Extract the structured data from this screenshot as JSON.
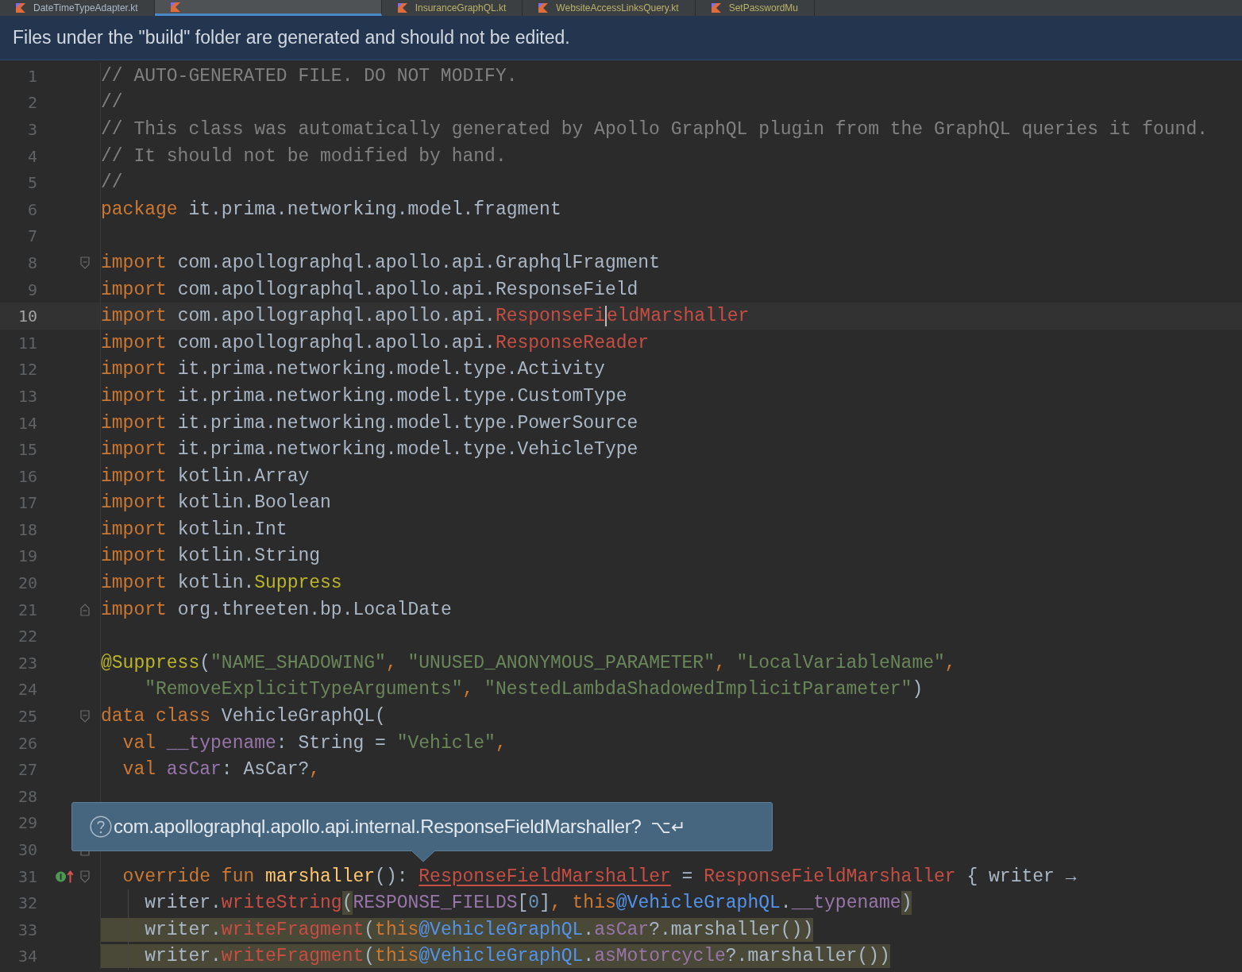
{
  "tabs": [
    {
      "label": "DateTimeTypeAdapter.kt",
      "selected": false
    },
    {
      "selected": true
    },
    {
      "label": "InsuranceGraphQL.kt",
      "selected": false
    },
    {
      "label": "WebsiteAccessLinksQuery.kt",
      "selected": false
    },
    {
      "label": "SetPasswordMu",
      "selected": false
    }
  ],
  "banner": {
    "text": "Files under the \"build\" folder are generated and should not be edited."
  },
  "lines": [
    {
      "n": "1",
      "tokens": [
        {
          "kind": "comment",
          "t": "// AUTO-GENERATED FILE. DO NOT MODIFY."
        }
      ]
    },
    {
      "n": "2",
      "tokens": [
        {
          "kind": "comment",
          "t": "//"
        }
      ]
    },
    {
      "n": "3",
      "tokens": [
        {
          "kind": "comment",
          "t": "// This class was automatically generated by Apollo GraphQL plugin from the GraphQL queries it found."
        }
      ]
    },
    {
      "n": "4",
      "tokens": [
        {
          "kind": "comment",
          "t": "// It should not be modified by hand."
        }
      ]
    },
    {
      "n": "5",
      "tokens": [
        {
          "kind": "comment",
          "t": "//"
        }
      ]
    },
    {
      "n": "6",
      "tokens": [
        {
          "kind": "keyword",
          "t": "package"
        },
        {
          "kind": "plain",
          "t": " it.prima.networking.model.fragment"
        }
      ]
    },
    {
      "n": "7"
    },
    {
      "n": "8",
      "fold_start": true,
      "tokens": [
        {
          "kind": "keyword",
          "t": "import"
        },
        {
          "kind": "plain",
          "t": " com.apollographql.apollo.api.GraphqlFragment"
        }
      ]
    },
    {
      "n": "9",
      "tokens": [
        {
          "kind": "keyword",
          "t": "import"
        },
        {
          "kind": "plain",
          "t": " com.apollographql.apollo.api.ResponseField"
        }
      ]
    },
    {
      "n": "10",
      "current": true,
      "tokens": [
        {
          "kind": "keyword",
          "t": "import"
        },
        {
          "kind": "plain",
          "t": " com.apollographql.apollo.api."
        },
        {
          "kind": "error",
          "t": "ResponseFi",
          "caret": true
        },
        {
          "kind": "error",
          "t": "eldMarshaller"
        }
      ]
    },
    {
      "n": "11",
      "tokens": [
        {
          "kind": "keyword",
          "t": "import"
        },
        {
          "kind": "plain",
          "t": " com.apollographql.apollo.api."
        },
        {
          "kind": "error",
          "t": "ResponseReader"
        }
      ]
    },
    {
      "n": "12",
      "tokens": [
        {
          "kind": "keyword",
          "t": "import"
        },
        {
          "kind": "plain",
          "t": " it.prima.networking.model.type.Activity"
        }
      ]
    },
    {
      "n": "13",
      "tokens": [
        {
          "kind": "keyword",
          "t": "import"
        },
        {
          "kind": "plain",
          "t": " it.prima.networking.model.type.CustomType"
        }
      ]
    },
    {
      "n": "14",
      "tokens": [
        {
          "kind": "keyword",
          "t": "import"
        },
        {
          "kind": "plain",
          "t": " it.prima.networking.model.type.PowerSource"
        }
      ]
    },
    {
      "n": "15",
      "tokens": [
        {
          "kind": "keyword",
          "t": "import"
        },
        {
          "kind": "plain",
          "t": " it.prima.networking.model.type.VehicleType"
        }
      ]
    },
    {
      "n": "16",
      "tokens": [
        {
          "kind": "keyword",
          "t": "import"
        },
        {
          "kind": "plain",
          "t": " kotlin.Array"
        }
      ]
    },
    {
      "n": "17",
      "tokens": [
        {
          "kind": "keyword",
          "t": "import"
        },
        {
          "kind": "plain",
          "t": " kotlin.Boolean"
        }
      ]
    },
    {
      "n": "18",
      "tokens": [
        {
          "kind": "keyword",
          "t": "import"
        },
        {
          "kind": "plain",
          "t": " kotlin.Int"
        }
      ]
    },
    {
      "n": "19",
      "tokens": [
        {
          "kind": "keyword",
          "t": "import"
        },
        {
          "kind": "plain",
          "t": " kotlin.String"
        }
      ]
    },
    {
      "n": "20",
      "tokens": [
        {
          "kind": "keyword",
          "t": "import"
        },
        {
          "kind": "plain",
          "t": " kotlin."
        },
        {
          "kind": "annotation",
          "t": "Suppress"
        }
      ]
    },
    {
      "n": "21",
      "fold_end": true,
      "tokens": [
        {
          "kind": "keyword",
          "t": "import"
        },
        {
          "kind": "plain",
          "t": " org.threeten.bp.LocalDate"
        }
      ]
    },
    {
      "n": "22"
    },
    {
      "n": "23",
      "tokens": [
        {
          "kind": "annotation",
          "t": "@Suppress"
        },
        {
          "kind": "plain",
          "t": "("
        },
        {
          "kind": "string",
          "t": "\"NAME_SHADOWING\""
        },
        {
          "kind": "keyword",
          "t": ", "
        },
        {
          "kind": "string",
          "t": "\"UNUSED_ANONYMOUS_PARAMETER\""
        },
        {
          "kind": "keyword",
          "t": ", "
        },
        {
          "kind": "string",
          "t": "\"LocalVariableName\""
        },
        {
          "kind": "keyword",
          "t": ","
        }
      ]
    },
    {
      "n": "24",
      "tokens": [
        {
          "kind": "string",
          "t": "    \"RemoveExplicitTypeArguments\""
        },
        {
          "kind": "keyword",
          "t": ", "
        },
        {
          "kind": "string",
          "t": "\"NestedLambdaShadowedImplicitParameter\""
        },
        {
          "kind": "plain",
          "t": ")"
        }
      ]
    },
    {
      "n": "25",
      "fold_start": true,
      "tokens": [
        {
          "kind": "keyword",
          "t": "data class"
        },
        {
          "kind": "plain",
          "t": " VehicleGraphQL("
        }
      ]
    },
    {
      "n": "26",
      "tokens": [
        {
          "kind": "keyword",
          "t": "  val "
        },
        {
          "kind": "prop",
          "t": "__typename"
        },
        {
          "kind": "plain",
          "t": ": String = "
        },
        {
          "kind": "string",
          "t": "\"Vehicle\""
        },
        {
          "kind": "keyword",
          "t": ","
        }
      ]
    },
    {
      "n": "27",
      "tokens": [
        {
          "kind": "keyword",
          "t": "  val "
        },
        {
          "kind": "prop",
          "t": "asCar"
        },
        {
          "kind": "plain",
          "t": ": AsCar?"
        },
        {
          "kind": "keyword",
          "t": ","
        }
      ]
    },
    {
      "n": "28"
    },
    {
      "n": "29"
    },
    {
      "n": "30",
      "fold_end": true
    },
    {
      "n": "31",
      "fold_start": true,
      "implements": true,
      "tokens": [
        {
          "kind": "keyword",
          "t": "  override fun "
        },
        {
          "kind": "fn",
          "t": "marshaller"
        },
        {
          "kind": "plain",
          "t": "(): "
        },
        {
          "kind": "error_ul",
          "t": "ResponseFieldMarshaller"
        },
        {
          "kind": "plain",
          "t": " = "
        },
        {
          "kind": "error",
          "t": "ResponseFieldMarshaller"
        },
        {
          "kind": "plain",
          "t": " { writer →"
        }
      ]
    },
    {
      "n": "32",
      "guide": true,
      "tokens": [
        {
          "kind": "plain",
          "t": "    writer."
        },
        {
          "kind": "error",
          "t": "writeString"
        },
        {
          "kind": "plain",
          "t": "(",
          "hl": true
        },
        {
          "kind": "prop",
          "t": "RESPONSE_FIELDS"
        },
        {
          "kind": "plain",
          "t": "["
        },
        {
          "kind": "number",
          "t": "0"
        },
        {
          "kind": "plain",
          "t": "]"
        },
        {
          "kind": "keyword",
          "t": ", this"
        },
        {
          "kind": "label",
          "t": "@VehicleGraphQL"
        },
        {
          "kind": "plain",
          "t": "."
        },
        {
          "kind": "prop",
          "t": "__typename"
        },
        {
          "kind": "plain",
          "t": ")",
          "hl": true
        }
      ]
    },
    {
      "n": "33",
      "guide": true,
      "tokens": [
        {
          "kind": "plain",
          "t": "    writer.",
          "hl": true
        },
        {
          "kind": "error",
          "t": "writeFragment",
          "hl": true
        },
        {
          "kind": "plain",
          "t": "(",
          "hl": true
        },
        {
          "kind": "keyword",
          "t": "this",
          "hl": true
        },
        {
          "kind": "label",
          "t": "@VehicleGraphQL",
          "hl": true
        },
        {
          "kind": "plain",
          "t": ".",
          "hl": true
        },
        {
          "kind": "prop",
          "t": "asCar",
          "hl": true
        },
        {
          "kind": "plain",
          "t": "?.marshaller())",
          "hl": true
        }
      ]
    },
    {
      "n": "34",
      "guide": true,
      "tokens": [
        {
          "kind": "plain",
          "t": "    writer.",
          "hl": true
        },
        {
          "kind": "error",
          "t": "writeFragment",
          "hl": true
        },
        {
          "kind": "plain",
          "t": "(",
          "hl": true
        },
        {
          "kind": "keyword",
          "t": "this",
          "hl": true
        },
        {
          "kind": "label",
          "t": "@VehicleGraphQL",
          "hl": true
        },
        {
          "kind": "plain",
          "t": ".",
          "hl": true
        },
        {
          "kind": "prop",
          "t": "asMotorcycle",
          "hl": true
        },
        {
          "kind": "plain",
          "t": "?.marshaller())",
          "hl": true
        }
      ]
    }
  ],
  "tooltip": {
    "text": "com.apollographql.apollo.api.internal.ResponseFieldMarshaller?",
    "shortcut": "⌥↵"
  }
}
